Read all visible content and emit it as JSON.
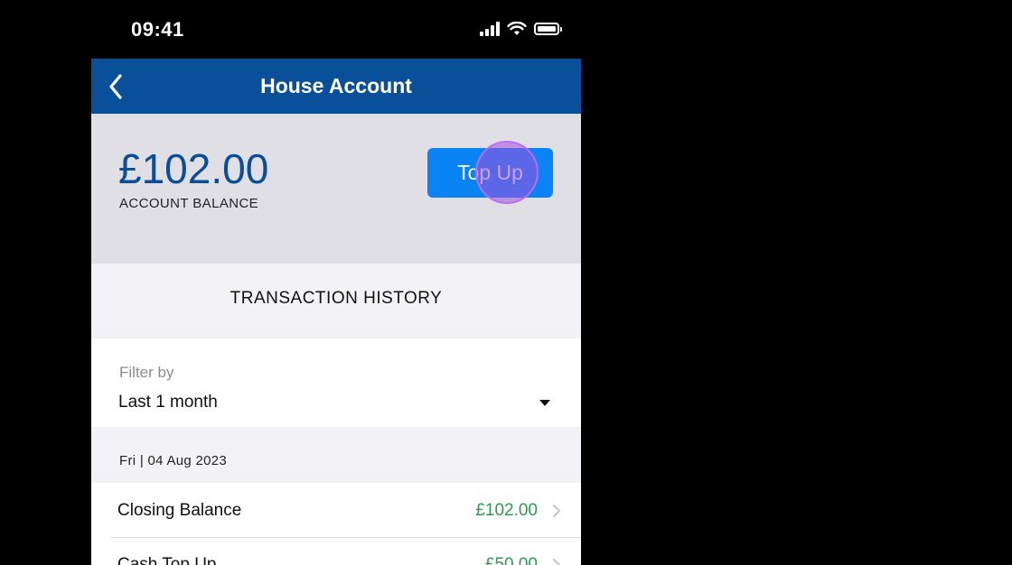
{
  "status_bar": {
    "time": "09:41"
  },
  "nav": {
    "title": "House Account"
  },
  "balance": {
    "amount": "£102.00",
    "label": "ACCOUNT BALANCE",
    "topup_label": "Top Up"
  },
  "history": {
    "header": "TRANSACTION HISTORY"
  },
  "filter": {
    "label": "Filter by",
    "value": "Last 1 month"
  },
  "date_header": "Fri | 04 Aug 2023",
  "transactions": [
    {
      "name": "Closing Balance",
      "amount": "£102.00"
    },
    {
      "name": "Cash Top Up",
      "amount": "£50.00"
    }
  ],
  "colors": {
    "nav_bg": "#0a4f9a",
    "balance_text": "#0b4d96",
    "button": "#0a84f5",
    "positive_amount": "#2e9a50"
  }
}
